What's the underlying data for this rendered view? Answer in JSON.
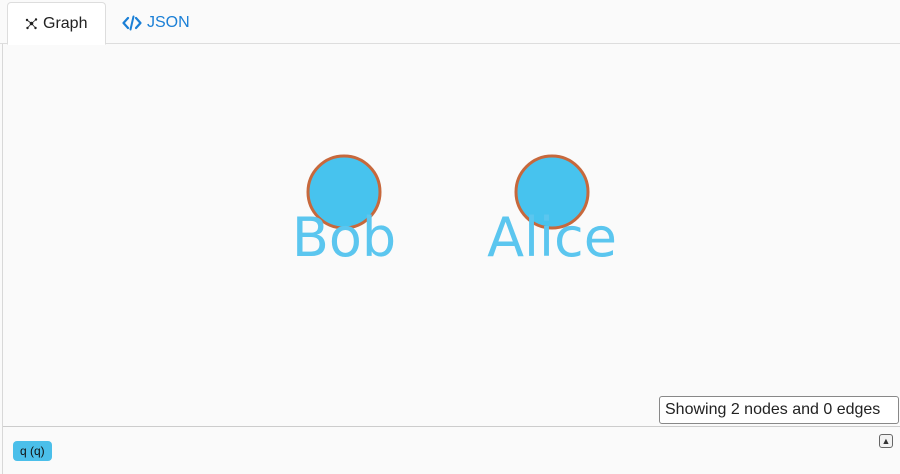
{
  "tabs": [
    {
      "label": "Graph",
      "icon": "graph-icon",
      "active": true
    },
    {
      "label": "JSON",
      "icon": "code-icon",
      "active": false
    }
  ],
  "graph": {
    "nodes": [
      {
        "label": "Bob"
      },
      {
        "label": "Alice"
      }
    ],
    "node_fill": "#47c3ee",
    "node_stroke": "#c7683c",
    "label_color": "#5bc6ef"
  },
  "status": {
    "text": "Showing 2 nodes and 0 edges"
  },
  "query": {
    "chip_label": "q (q)"
  },
  "colors": {
    "accent": "#1a7fd6",
    "chip": "#4bbfea"
  }
}
